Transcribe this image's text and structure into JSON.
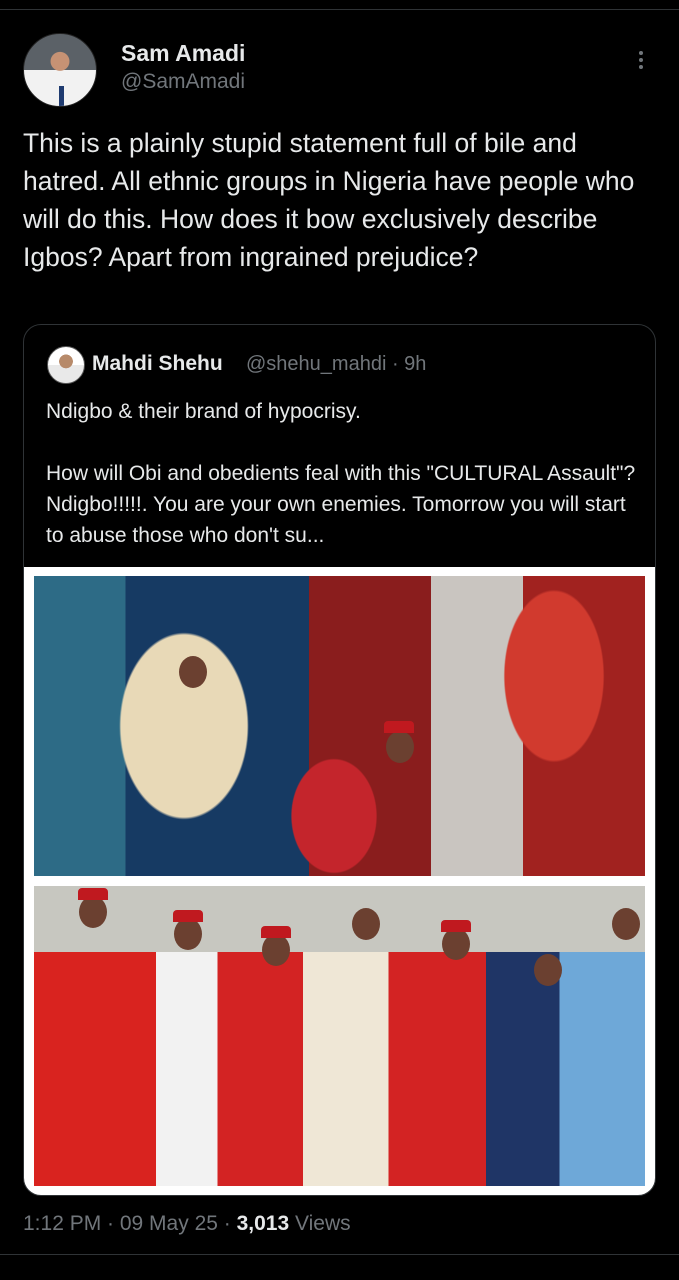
{
  "author": {
    "name": "Sam Amadi",
    "handle": "@SamAmadi"
  },
  "tweet": {
    "text": "This is a plainly stupid statement full of bile and hatred. All ethnic groups in Nigeria have people who will do this. How does it bow exclusively describe Igbos? Apart from ingrained prejudice?"
  },
  "quoted": {
    "name": "Mahdi Shehu",
    "handle_time": "@shehu_mahdi · 9h",
    "text": "Ndigbo &  their brand of hypocrisy.\n\n How will Obi and obedients  feal with this \"CULTURAL Assault\"? Ndigbo!!!!!. You are your own enemies. Tomorrow you will start to abuse those who don't su..."
  },
  "footer": {
    "time_date": "1:12 PM · 09 May 25 · ",
    "views_count": "3,013",
    "views_label": " Views"
  },
  "icons": {
    "more": "more-vertical-icon"
  }
}
